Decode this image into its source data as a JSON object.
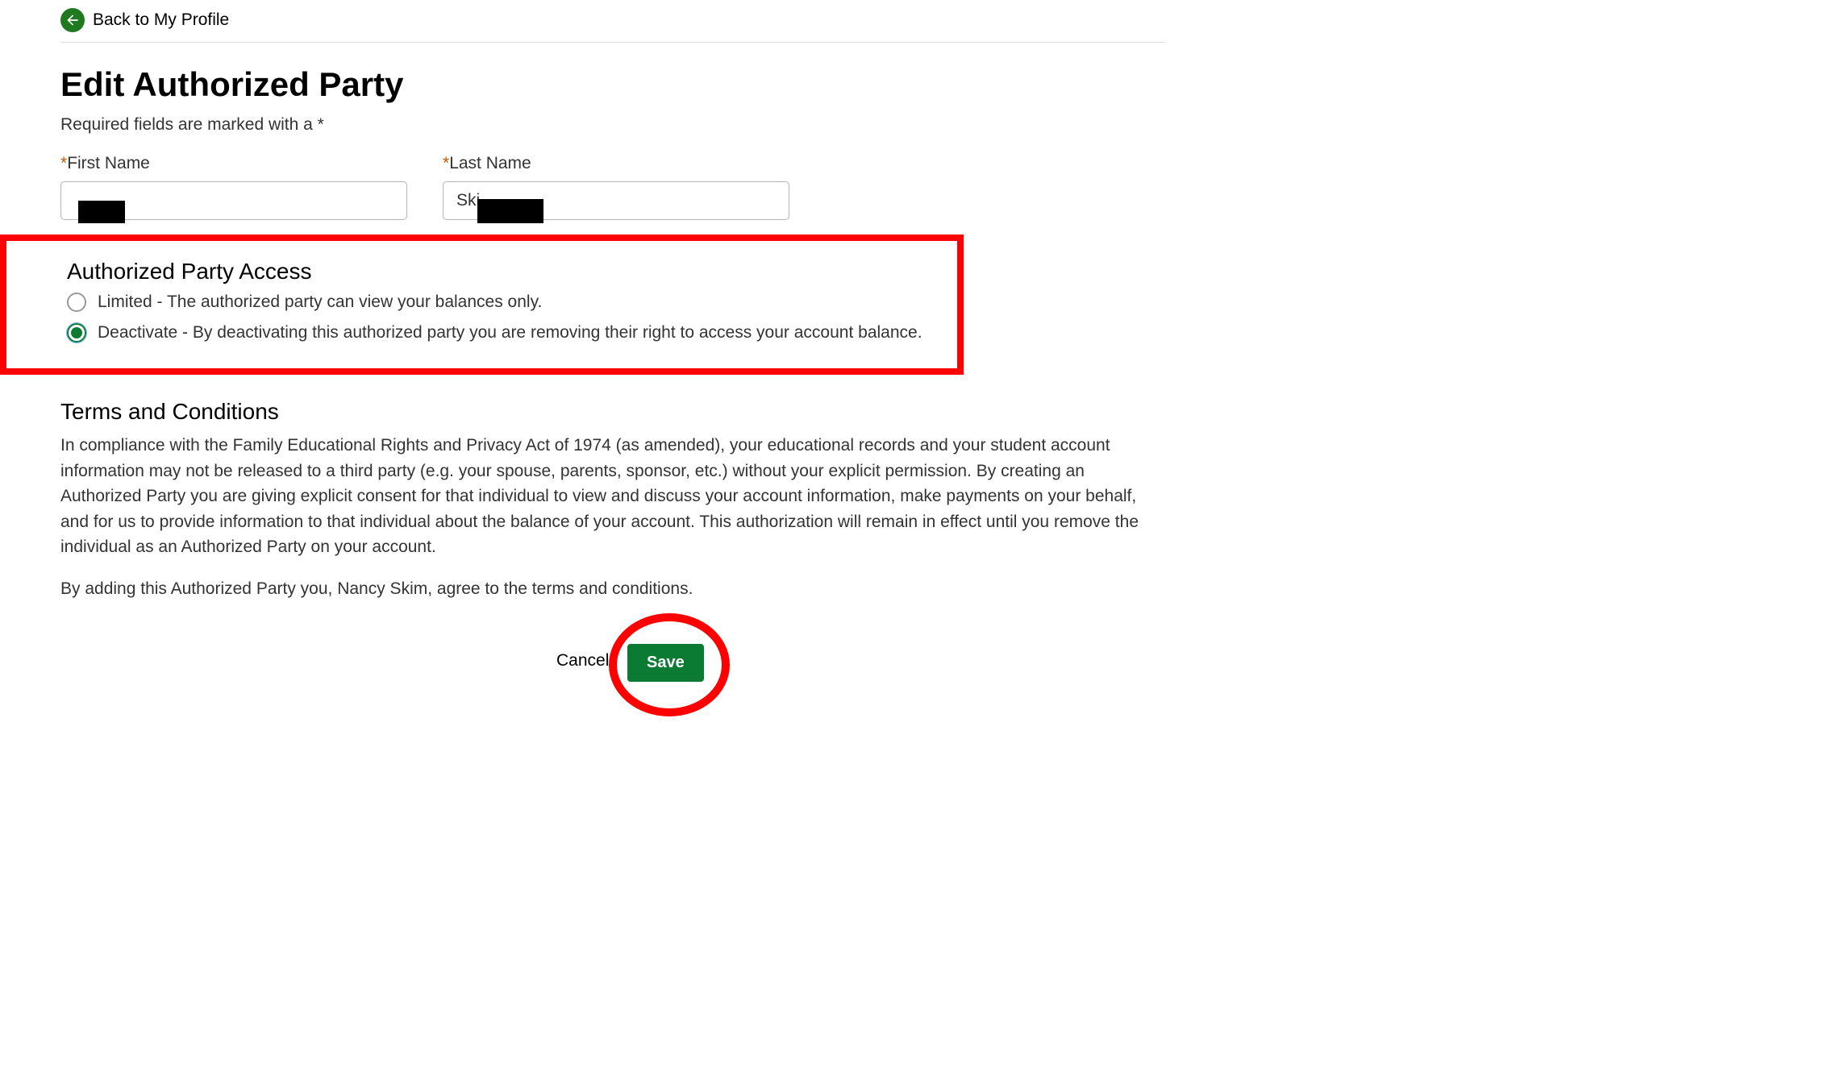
{
  "back_link": {
    "label": "Back to My Profile"
  },
  "page_title": "Edit Authorized Party",
  "required_note": "Required fields are marked with a *",
  "form": {
    "first_name": {
      "label": "First Name",
      "value": ""
    },
    "last_name": {
      "label": "Last Name",
      "value": "Ski"
    }
  },
  "access_section": {
    "title": "Authorized Party Access",
    "options": [
      {
        "label": "Limited - The authorized party can view your balances only.",
        "selected": false
      },
      {
        "label": "Deactivate - By deactivating this authorized party you are removing their right to access your account balance.",
        "selected": true
      }
    ]
  },
  "terms_section": {
    "title": "Terms and Conditions",
    "paragraph1": "In compliance with the Family Educational Rights and Privacy Act of 1974 (as amended), your educational records and your student account information may not be released to a third party (e.g. your spouse, parents, sponsor, etc.) without your explicit permission. By creating an Authorized Party you are giving explicit consent for that individual to view and discuss your account information, make payments on your behalf, and for us to provide information to that individual about the balance of your account. This authorization will remain in effect until you remove the individual as an Authorized Party on your account.",
    "paragraph2": "By adding this Authorized Party you, Nancy Skim, agree to the terms and conditions."
  },
  "buttons": {
    "cancel": "Cancel",
    "save": "Save"
  }
}
